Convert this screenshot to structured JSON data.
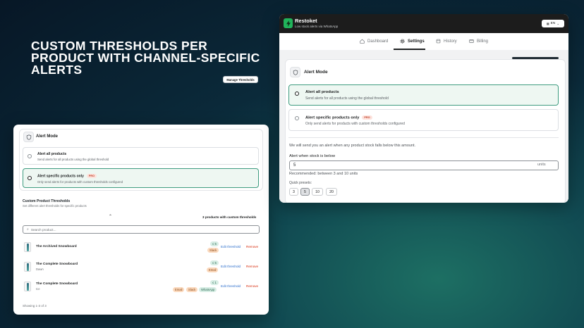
{
  "headline": [
    "CUSTOM THRESHOLDS PER",
    "PRODUCT WITH CHANNEL-SPECIFIC",
    "ALERTS"
  ],
  "left": {
    "alert_mode_title": "Alert Mode",
    "options": [
      {
        "title": "Alert all products",
        "desc": "Send alerts for all products using the global threshold",
        "selected": false
      },
      {
        "title": "Alert specific products only",
        "badge": "PRO",
        "desc": "Only send alerts for products with custom thresholds configured",
        "selected": true
      }
    ],
    "custom_title": "Custom Product Thresholds",
    "custom_desc": "Set different alert thresholds for specific products",
    "manage_button": "Manage Thresholds",
    "count_label": "3 products with custom thresholds",
    "search_placeholder": "Search product...",
    "products": [
      {
        "name": "The Archived Snowboard",
        "sub": "",
        "threshold": "≤ 5",
        "channels": [
          "Slack"
        ]
      },
      {
        "name": "The Complete Snowboard",
        "sub": "Dawn",
        "threshold": "≤ 5",
        "channels": [
          "Email"
        ]
      },
      {
        "name": "The Complete Snowboard",
        "sub": "Ice",
        "threshold": "≤ 1",
        "channels": [
          "Email",
          "Slack",
          "WhatsApp"
        ]
      }
    ],
    "edit_label": "Edit threshold",
    "remove_label": "Remove",
    "showing": "Showing 1-3 of 3"
  },
  "right": {
    "brand": "Restoket",
    "tagline": "Low stock alerts via WhatsApp",
    "lang": "EN",
    "tabs": [
      "Dashboard",
      "Settings",
      "History",
      "Billing"
    ],
    "active_tab": "Settings",
    "alert_mode_title": "Alert Mode",
    "options": [
      {
        "title": "Alert all products",
        "desc": "Send alerts for all products using the global threshold",
        "selected": true
      },
      {
        "title": "Alert specific products only",
        "badge": "PRO",
        "desc": "Only send alerts for products with custom thresholds configured",
        "selected": false
      }
    ],
    "info_text": "We will send you an alert when any product stock falls below this amount.",
    "field_label": "Alert when stock is below",
    "field_value": "5",
    "field_units": "units",
    "recommend": "Recommended: between 3 and 10 units",
    "presets_label": "Quick presets:",
    "presets": [
      "3",
      "5",
      "10",
      "20"
    ],
    "active_preset": "5"
  },
  "colors": {
    "selected_border": "#3f9c80",
    "selected_bg": "#eef7f2",
    "brand_green": "#21b35a",
    "link_blue": "#2c6ecb",
    "remove_red": "#d72c0d"
  }
}
